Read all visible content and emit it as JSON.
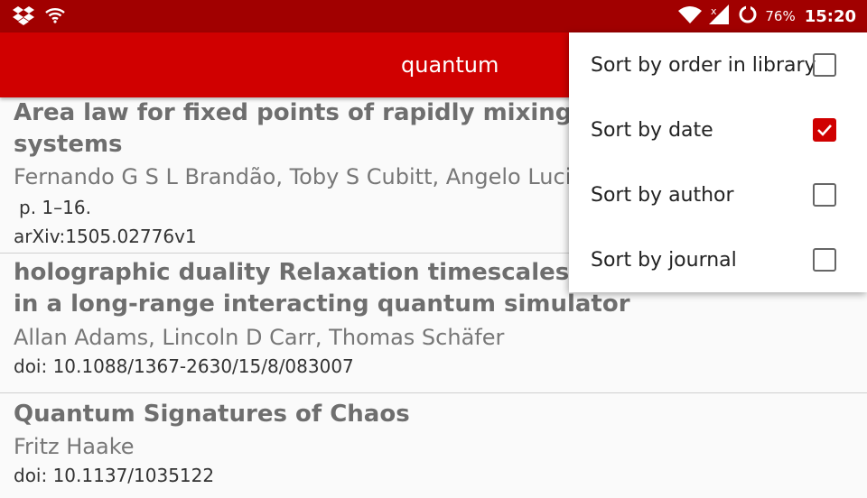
{
  "status_bar": {
    "icons_left": [
      "dropbox-icon",
      "wifi-icon"
    ],
    "icons_right": [
      "wifi-icon",
      "signal-no-sim-icon",
      "sync-icon"
    ],
    "battery": "76%",
    "time": "15:20"
  },
  "app_bar": {
    "title": "quantum",
    "color": "#d00000"
  },
  "papers": [
    {
      "title_line1": "Area law for fixed points of rapidly mixing diss",
      "title_line2": "systems",
      "authors": "Fernando G S L Brandão, Toby S Cubitt, Angelo Luci",
      "pages": "p. 1–16.",
      "identifier": "arXiv:1505.02776v1"
    },
    {
      "title_line1": "holographic duality Relaxation timescales and",
      "title_line2": "in a long-range interacting quantum simulator",
      "authors": "Allan Adams, Lincoln D Carr, Thomas Schäfer",
      "identifier": "doi: 10.1088/1367-2630/15/8/083007"
    },
    {
      "title_line1": "Quantum Signatures of Chaos",
      "authors": "Fritz Haake",
      "identifier": "doi: 10.1137/1035122"
    }
  ],
  "sort_menu": {
    "items": [
      {
        "label": "Sort by order in library",
        "checked": false
      },
      {
        "label": "Sort by date",
        "checked": true
      },
      {
        "label": "Sort by author",
        "checked": false
      },
      {
        "label": "Sort by journal",
        "checked": false
      }
    ]
  }
}
